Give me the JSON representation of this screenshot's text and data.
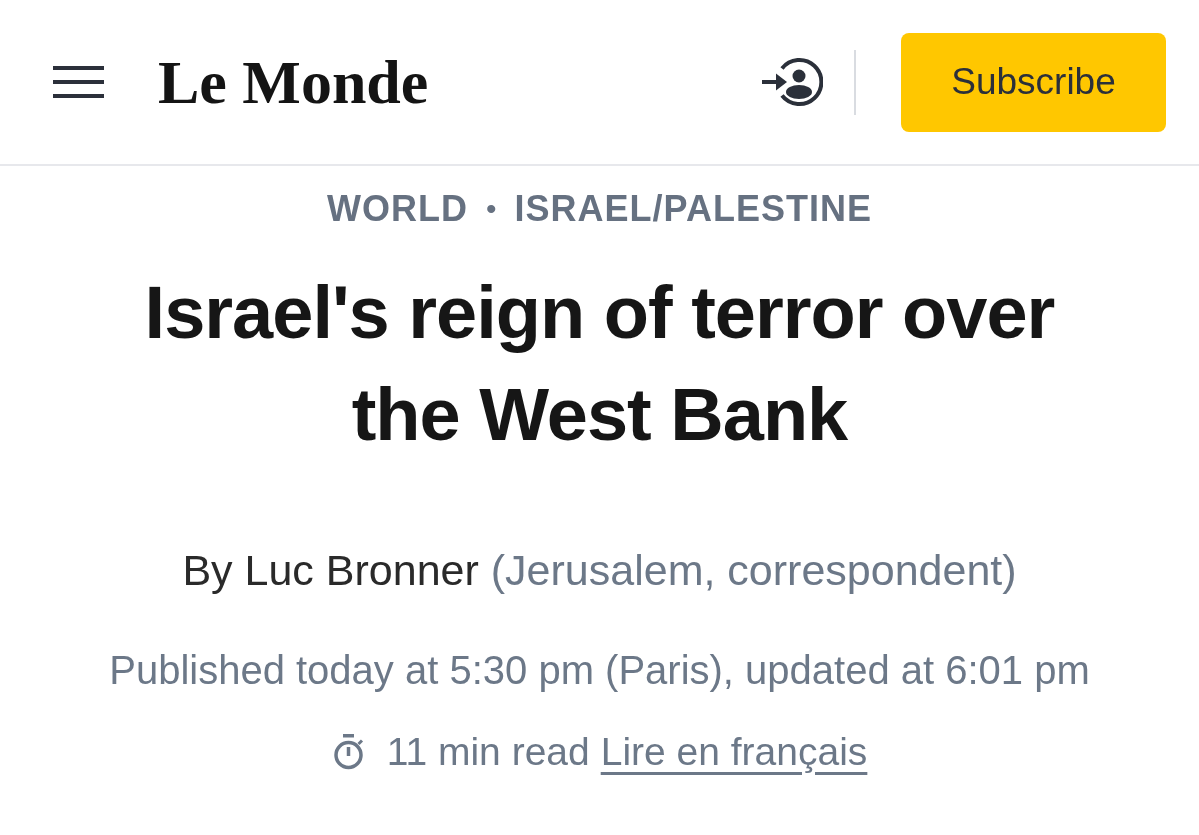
{
  "header": {
    "logo": "Le Monde",
    "subscribe_button": "Subscribe"
  },
  "breadcrumb": {
    "items": [
      "WORLD",
      "ISRAEL/PALESTINE"
    ],
    "separator": "•"
  },
  "headline": "Israel's reign of terror over the West Bank",
  "byline": {
    "author": "By Luc Bronner",
    "role": "(Jerusalem, correspondent)"
  },
  "published": "Published today at 5:30 pm (Paris), updated at 6:01 pm",
  "reading": {
    "time": "11 min read",
    "translation_link": "Lire en français"
  }
}
